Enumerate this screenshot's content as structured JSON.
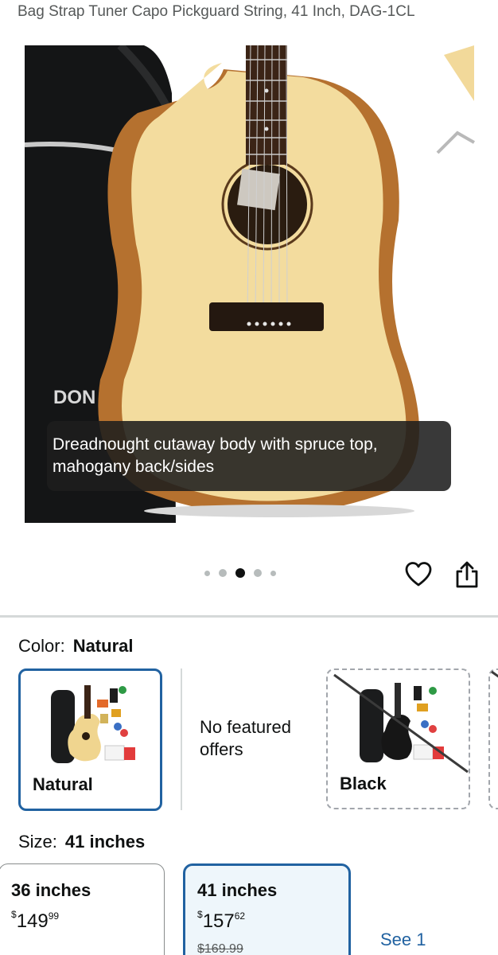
{
  "product": {
    "title": "Bag Strap Tuner Capo Pickguard String, 41 Inch, DAG-1CL"
  },
  "gallery": {
    "caption": "Dreadnought cutaway body with spruce top, mahogany back/sides",
    "dot_count": 5,
    "active_index": 2
  },
  "color": {
    "label": "Color:",
    "selected": "Natural",
    "options": [
      {
        "name": "Natural",
        "state": "selected"
      },
      {
        "name": "No featured offers",
        "state": "message"
      },
      {
        "name": "Black",
        "state": "unavailable"
      }
    ]
  },
  "size": {
    "label": "Size:",
    "selected": "41 inches",
    "options": [
      {
        "name": "36 inches",
        "currency": "$",
        "dollars": "149",
        "cents": "99"
      },
      {
        "name": "41 inches",
        "currency": "$",
        "dollars": "157",
        "cents": "62",
        "list_price": "$169.99"
      }
    ],
    "see_more": "See 1"
  },
  "colors": {
    "accent": "#2162a1",
    "text": "#0f1111",
    "muted": "#565959",
    "divider": "#d5d9d9"
  }
}
